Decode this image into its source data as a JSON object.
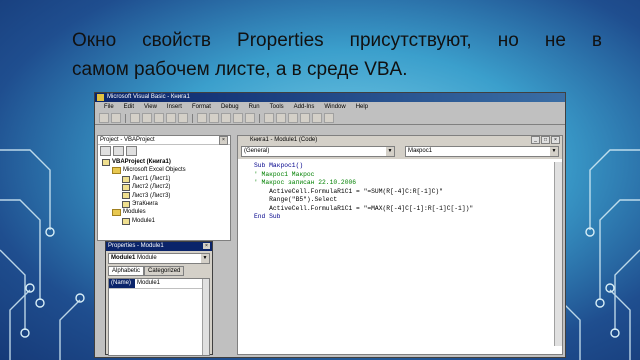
{
  "slide": {
    "line1": "Окно свойств Properties присутствуют, но не в",
    "line2": "самом рабочем листе, а в среде VBA."
  },
  "colors": {
    "accent": "#0a246a",
    "comment": "#008000",
    "keyword": "#00008b"
  },
  "vbe": {
    "title": "Microsoft Visual Basic - Книга1",
    "menu": [
      "File",
      "Edit",
      "View",
      "Insert",
      "Format",
      "Debug",
      "Run",
      "Tools",
      "Add-Ins",
      "Window",
      "Help"
    ],
    "toolbar_icons": [
      "excel-icon",
      "insert-module-icon",
      "save-icon",
      "cut-icon",
      "copy-icon",
      "paste-icon",
      "find-icon",
      "undo-icon",
      "redo-icon",
      "run-icon",
      "pause-icon",
      "reset-icon",
      "design-icon",
      "project-icon",
      "properties-icon",
      "object-browser-icon",
      "toolbox-icon",
      "help-icon"
    ],
    "project": {
      "title": "Project - VBAProject",
      "tree": [
        {
          "label": "VBAProject (Книга1)",
          "indent": 0
        },
        {
          "label": "Microsoft Excel Objects",
          "indent": 1
        },
        {
          "label": "Лист1 (Лист1)",
          "indent": 2
        },
        {
          "label": "Лист2 (Лист2)",
          "indent": 2
        },
        {
          "label": "Лист3 (Лист3)",
          "indent": 2
        },
        {
          "label": "ЭтаКнига",
          "indent": 2
        },
        {
          "label": "Modules",
          "indent": 1
        },
        {
          "label": "Module1",
          "indent": 2
        }
      ]
    },
    "properties": {
      "title": "Properties - Module1",
      "object": "Module1",
      "object_type": "Module",
      "tabs": [
        "Alphabetic",
        "Categorized"
      ],
      "rows": [
        {
          "name": "(Name)",
          "value": "Module1"
        }
      ]
    },
    "code": {
      "title": "Книга1 - Module1 (Code)",
      "object_combo": "(General)",
      "proc_combo": "Макрос1",
      "lines": [
        {
          "text": "Sub Макрос1()",
          "type": "kw"
        },
        {
          "text": "' Макрос1 Макрос",
          "type": "cm"
        },
        {
          "text": "' Макрос записан 22.10.2006",
          "type": "cm"
        },
        {
          "text": "    ActiveCell.FormulaR1C1 = \"=SUM(R[-4]C:R[-1]C)\"",
          "type": "n"
        },
        {
          "text": "    Range(\"B5\").Select",
          "type": "n"
        },
        {
          "text": "    ActiveCell.FormulaR1C1 = \"=MAX(R[-4]C[-1]:R[-1]C[-1])\"",
          "type": "n"
        },
        {
          "text": "End Sub",
          "type": "kw"
        }
      ]
    }
  }
}
